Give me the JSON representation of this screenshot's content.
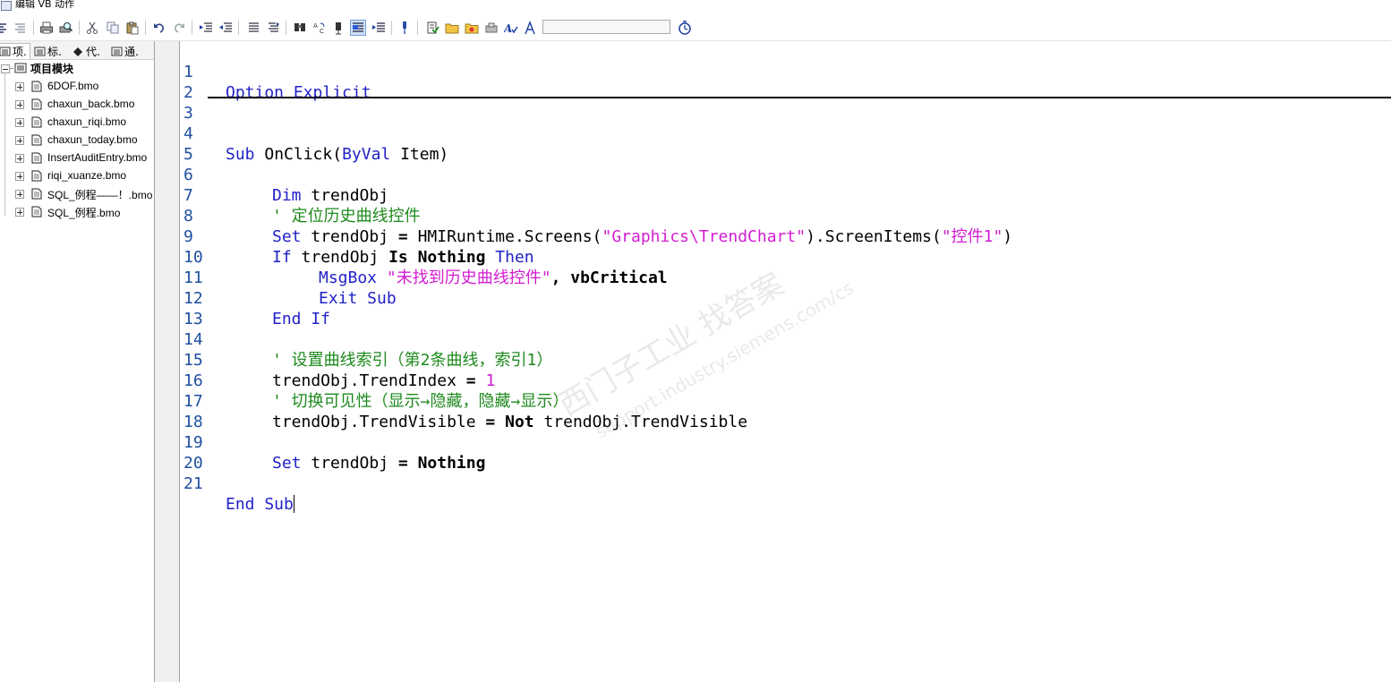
{
  "window": {
    "title": "编辑 VB 动作"
  },
  "toolbar": {
    "search_value": "",
    "buttons": [
      "align-left-icon",
      "align-right-icon",
      "print-icon",
      "print-preview-icon",
      "cut-icon",
      "copy-icon",
      "paste-icon",
      "undo-icon",
      "redo-icon",
      "indent-icon",
      "outdent-icon",
      "comment-icon",
      "uncomment-icon",
      "find-icon",
      "replace-icon",
      "goto-icon",
      "bookmark-toggle-icon",
      "bookmark-next-icon",
      "pin-icon",
      "import-icon",
      "folder-icon",
      "folder-add-icon",
      "printer-icon",
      "syntax-check-icon",
      "lambda-icon",
      "timer-icon"
    ]
  },
  "tabs": [
    {
      "label": "项.",
      "active": true
    },
    {
      "label": "标.",
      "active": false
    },
    {
      "label": "代.",
      "active": false
    },
    {
      "label": "通.",
      "active": false
    }
  ],
  "tree": {
    "root_label": "项目模块",
    "items": [
      "6DOF.bmo",
      "chaxun_back.bmo",
      "chaxun_riqi.bmo",
      "chaxun_today.bmo",
      "InsertAuditEntry.bmo",
      "riqi_xuanze.bmo",
      "SQL_例程——！.bmo",
      "SQL_例程.bmo"
    ]
  },
  "editor": {
    "line_numbers": [
      "1",
      "2",
      "3",
      "4",
      "5",
      "6",
      "7",
      "8",
      "9",
      "10",
      "11",
      "12",
      "13",
      "14",
      "15",
      "16",
      "17",
      "18",
      "19",
      "20",
      "21"
    ],
    "tokens": {
      "l1_option": "Option Explicit",
      "l4_sub": "Sub",
      "l4_onclick": " OnClick(",
      "l4_byval": "ByVal",
      "l4_item": " Item)",
      "l6_dim": "Dim",
      "l6_rest": " trendObj",
      "l7_comment": "' 定位历史曲线控件",
      "l8_set": "Set",
      "l8_a": " trendObj ",
      "l8_eq": "=",
      "l8_b": " HMIRuntime.Screens(",
      "l8_str1": "\"Graphics\\TrendChart\"",
      "l8_c": ").ScreenItems(",
      "l8_str2": "\"控件1\"",
      "l8_d": ")",
      "l9_if": "If",
      "l9_a": " trendObj ",
      "l9_is": "Is",
      "l9_sp": " ",
      "l9_nothing": "Nothing",
      "l9_sp2": " ",
      "l9_then": "Then",
      "l10_msgbox": "MsgBox",
      "l10_sp": " ",
      "l10_str": "\"未找到历史曲线控件\"",
      "l10_comma": ",",
      "l10_sp2": " ",
      "l10_vbcrit": "vbCritical",
      "l11_exit": "Exit Sub",
      "l12_endif": "End If",
      "l14_comment": "' 设置曲线索引（第2条曲线，索引1）",
      "l15_a": "trendObj.TrendIndex ",
      "l15_eq": "=",
      "l15_sp": " ",
      "l15_num": "1",
      "l16_comment": "' 切换可见性（显示→隐藏，隐藏→显示）",
      "l17_a": "trendObj.TrendVisible ",
      "l17_eq": "=",
      "l17_sp": " ",
      "l17_not": "Not",
      "l17_b": " trendObj.TrendVisible",
      "l19_set": "Set",
      "l19_a": " trendObj ",
      "l19_eq": "=",
      "l19_sp": " ",
      "l19_nothing": "Nothing",
      "l21_end": "End Sub"
    }
  },
  "watermark": {
    "text_cn": "西门子工业 找答案",
    "text_url": "support.industry.siemens.com/cs"
  }
}
